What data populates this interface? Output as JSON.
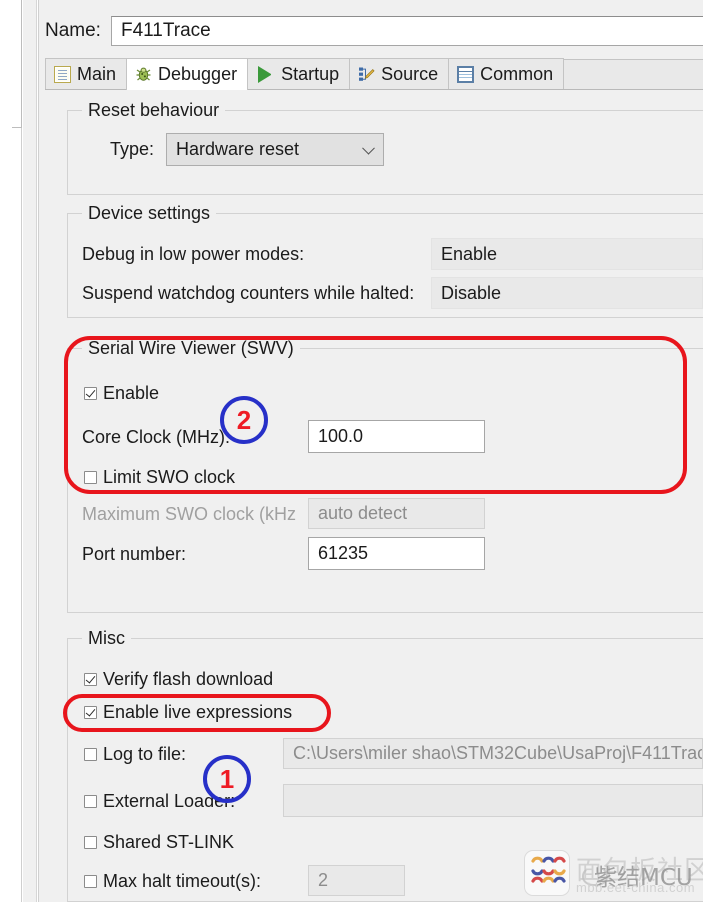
{
  "window": {
    "name_label": "Name:",
    "name_value": "F411Trace"
  },
  "tabs": [
    {
      "label": "Main",
      "icon": "document-icon",
      "active": false
    },
    {
      "label": "Debugger",
      "icon": "bug-icon",
      "active": true
    },
    {
      "label": "Startup",
      "icon": "play-icon",
      "active": false
    },
    {
      "label": "Source",
      "icon": "source-edit-icon",
      "active": false
    },
    {
      "label": "Common",
      "icon": "table-icon",
      "active": false
    }
  ],
  "reset_behaviour": {
    "legend": "Reset behaviour",
    "type_label": "Type:",
    "type_value": "Hardware reset"
  },
  "device_settings": {
    "legend": "Device settings",
    "low_power_label": "Debug in low power modes:",
    "low_power_value": "Enable",
    "watchdog_label": "Suspend watchdog counters while halted:",
    "watchdog_value": "Disable"
  },
  "swv": {
    "legend": "Serial Wire Viewer (SWV)",
    "enable_label": "Enable",
    "enable_checked": true,
    "core_clock_label": "Core Clock (MHz):",
    "core_clock_value": "100.0",
    "limit_swo_label": "Limit SWO clock",
    "limit_swo_checked": false,
    "max_swo_label": "Maximum SWO clock (kHz",
    "max_swo_value": "auto detect",
    "port_label": "Port number:",
    "port_value": "61235"
  },
  "misc": {
    "legend": "Misc",
    "verify_flash_label": "Verify flash download",
    "verify_flash_checked": true,
    "live_expressions_label": "Enable live expressions",
    "live_expressions_checked": true,
    "log_to_file_label": "Log to file:",
    "log_to_file_checked": false,
    "log_to_file_value": "C:\\Users\\miler shao\\STM32Cube\\UsaProj\\F411Trac",
    "external_loader_label": "External Loader:",
    "external_loader_checked": false,
    "external_loader_value": "",
    "shared_stlink_label": "Shared ST-LINK",
    "shared_stlink_checked": false,
    "max_halt_label": "Max halt timeout(s):",
    "max_halt_checked": false,
    "max_halt_value": "2"
  },
  "annotations": [
    {
      "id": "anno-1",
      "text": "1"
    },
    {
      "id": "anno-2",
      "text": "2"
    }
  ],
  "watermark": {
    "cn_text": "面包板社区",
    "mcu_text": "紫结MCU",
    "url_text": "mbb.eet-china.com"
  },
  "colors": {
    "annotation_circle": "#2730c8",
    "annotation_number": "#ee1b24",
    "highlight_box": "#e8151c",
    "dialog_bg": "#f0f0f0"
  }
}
